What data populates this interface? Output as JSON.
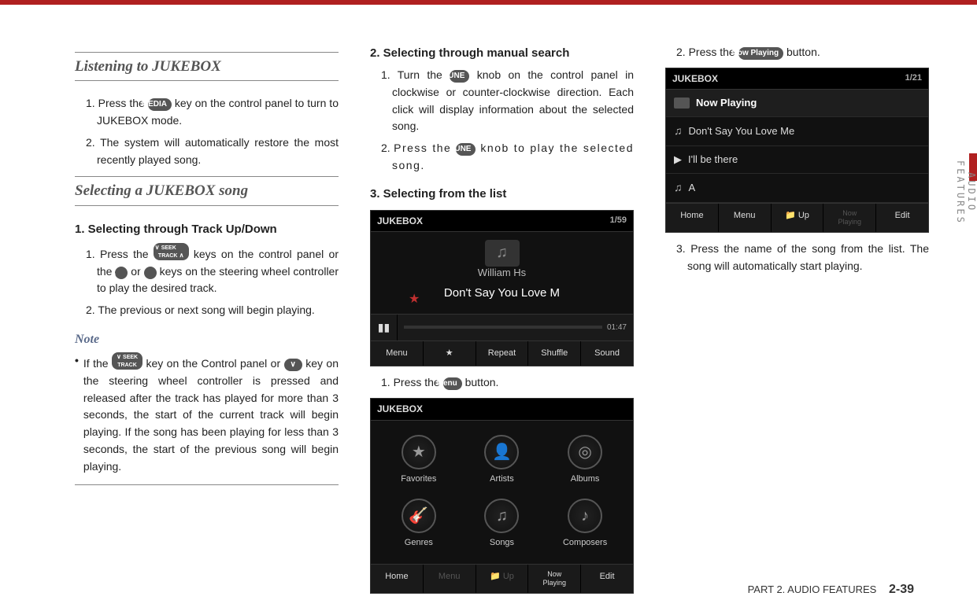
{
  "col1": {
    "h1": "Listening to JUKEBOX",
    "l1": "Press the ",
    "l1b": " key on the control panel to turn to JUKEBOX mode.",
    "l2": "The system will automatically restore the most recently played song.",
    "h2": "Selecting a JUKEBOX song",
    "sub1": "1. Selecting through Track Up/Down",
    "s1a": "Press the ",
    "s1b": " keys on the control panel or the ",
    "s1c": " or ",
    "s1d": " keys on the steering wheel controller to play the desired track.",
    "s2": "The previous or next song will begin playing.",
    "note_label": "Note",
    "note_a": "If the ",
    "note_b": " key on the Control panel or ",
    "note_c": " key on the steering wheel controller is pressed and released after the track has played for more than 3 seconds, the start of the current track will begin playing. If the song has been playing for less than 3 seconds, the start of the previous song will begin playing."
  },
  "col2": {
    "sub2": "2. Selecting through manual search",
    "m1a": "Turn the ",
    "m1b": " knob on the control panel in clockwise or counter-clockwise direction. Each click will display information about the selected song.",
    "m2a": "Press the ",
    "m2b": " knob to play the selected song.",
    "sub3": "3. Selecting from the list",
    "p1a": "Press the ",
    "p1b": " button."
  },
  "col3": {
    "r2a": "Press the ",
    "r2b": " button.",
    "r3": "Press the name of the song from the list. The song will automatically start playing."
  },
  "keys": {
    "media": "MEDIA",
    "seek_track_both": "∨ SEEK TRACK ∧",
    "seek_track_down": "∨ SEEK TRACK",
    "up": "∧",
    "down": "∨",
    "tune": "TUNE",
    "menu": "Menu",
    "now_playing": "Now Playing"
  },
  "screens": {
    "s1": {
      "title": "JUKEBOX",
      "counter": "1/59",
      "artist": "William Hs",
      "song": "Don't Say You Love M",
      "time": "01:47",
      "buttons": [
        "Menu",
        "★",
        "Repeat",
        "Shuffle",
        "Sound"
      ]
    },
    "s2": {
      "title": "JUKEBOX",
      "icons": [
        "Favorites",
        "Artists",
        "Albums",
        "Genres",
        "Songs",
        "Composers"
      ],
      "bottom": [
        "Home",
        "Menu",
        "Up",
        "Now Playing",
        "Edit"
      ]
    },
    "s3": {
      "title": "JUKEBOX",
      "counter": "1/21",
      "head": "Now Playing",
      "rows": [
        "Don't Say You Love Me",
        "I'll be there",
        "A"
      ],
      "bottom": [
        "Home",
        "Menu",
        "Up",
        "Now Playing",
        "Edit"
      ]
    }
  },
  "side": "AUDIO FEATURES",
  "footer_part": "PART 2. AUDIO FEATURES",
  "footer_page": "2-39"
}
